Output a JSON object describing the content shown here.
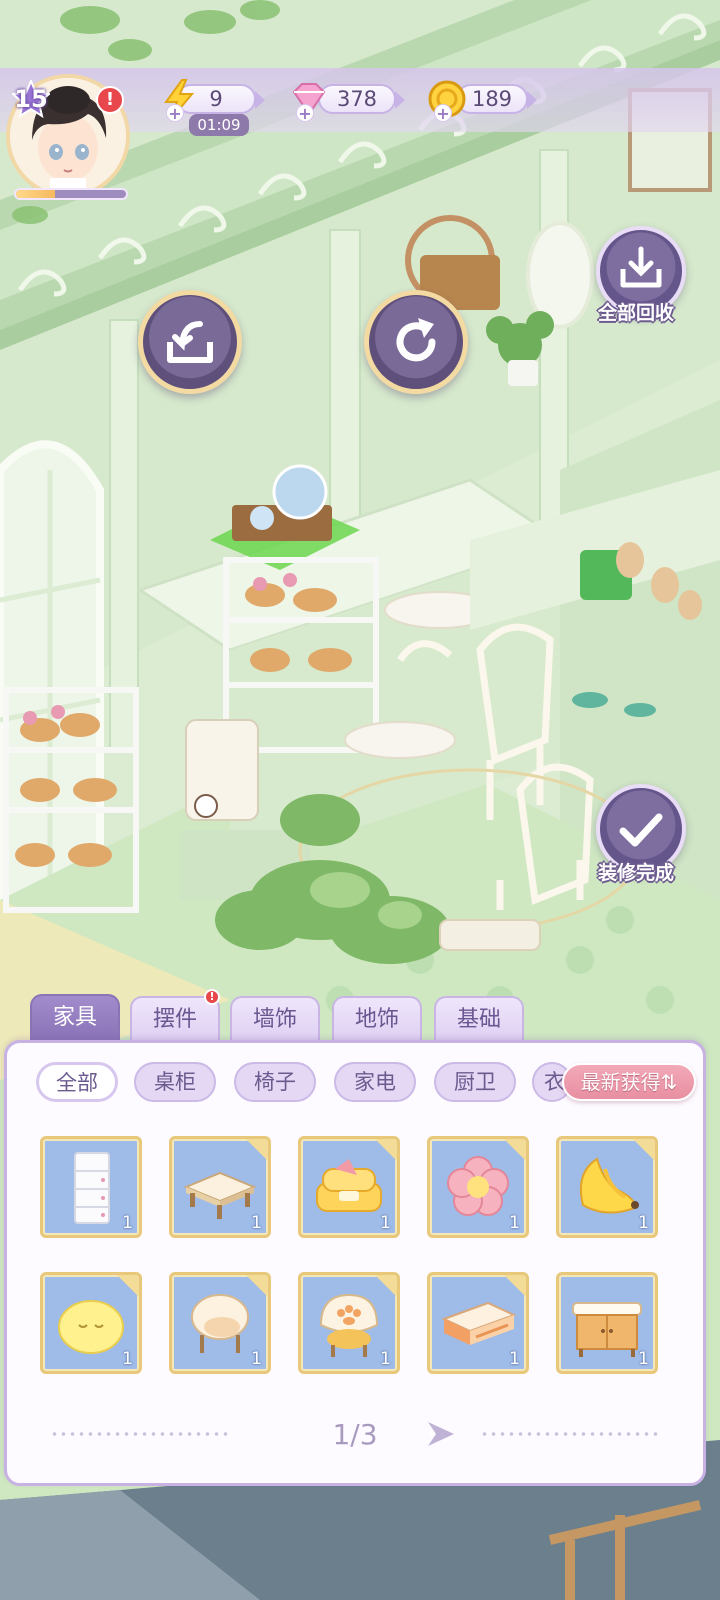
{
  "player": {
    "level": "15",
    "alert": "!",
    "xp_progress": 0.35
  },
  "resources": {
    "energy": {
      "value": "9",
      "timer": "01:09",
      "icon": "lightning-icon",
      "plus": "+"
    },
    "gems": {
      "value": "378",
      "icon": "diamond-icon",
      "plus": "+"
    },
    "coins": {
      "value": "189",
      "icon": "coin-icon",
      "plus": "+"
    }
  },
  "actions": {
    "store_all_label": "全部回收",
    "finish_label": "装修完成",
    "store_icon": "tray-arrow-icon",
    "rotate_icon": "rotate-icon"
  },
  "category_tabs": [
    {
      "label": "家具",
      "active": true
    },
    {
      "label": "摆件",
      "badge": "!"
    },
    {
      "label": "墙饰"
    },
    {
      "label": "地饰"
    },
    {
      "label": "基础"
    }
  ],
  "subtabs": [
    {
      "label": "全部",
      "active": true
    },
    {
      "label": "桌柜"
    },
    {
      "label": "椅子"
    },
    {
      "label": "家电"
    },
    {
      "label": "厨卫"
    },
    {
      "label": "衣"
    }
  ],
  "sort_label": "最新获得⇅",
  "items": [
    {
      "name": "white-drawer-cabinet",
      "count": "1",
      "corner": false
    },
    {
      "name": "low-coffee-table",
      "count": "1",
      "corner": true
    },
    {
      "name": "yellow-sofa",
      "count": "1",
      "corner": true
    },
    {
      "name": "flower-rug",
      "count": "1",
      "corner": true
    },
    {
      "name": "banana-chair",
      "count": "1",
      "corner": true
    },
    {
      "name": "cat-bean-bag",
      "count": "1",
      "corner": true
    },
    {
      "name": "cream-armchair",
      "count": "1",
      "corner": true
    },
    {
      "name": "paw-chair",
      "count": "1",
      "corner": true
    },
    {
      "name": "orange-tv-stand",
      "count": "1",
      "corner": true
    },
    {
      "name": "wooden-sideboard",
      "count": "1",
      "corner": false
    }
  ],
  "pager": {
    "text": "1/3"
  },
  "colors": {
    "accent": "#8670b4",
    "panel_border": "#c7b2e3",
    "card_bg": "#9fbbe8",
    "sort_button": "#e88fa2"
  }
}
